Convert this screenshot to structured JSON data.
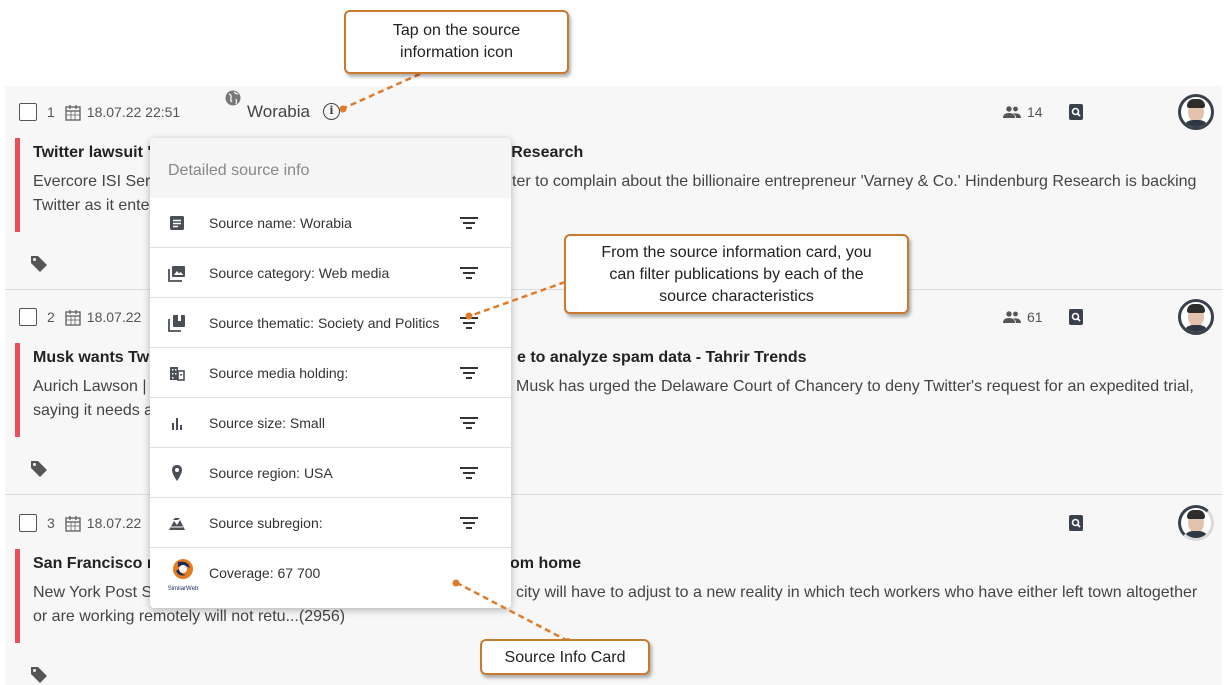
{
  "feed": {
    "items": [
      {
        "index": "1",
        "date": "18.07.22 22:51",
        "source": "Worabia",
        "title": "Twitter lawsuit '",
        "title_tail": "g Research",
        "snippet_line1_left": "Evercore ISI Ser",
        "snippet_line1_right": "ter to complain about the billionaire entrepreneur 'Varney & Co.' Hindenburg Research is backing",
        "snippet_line2_left": "Twitter as it ente",
        "audience": "14"
      },
      {
        "index": "2",
        "date": "18.07.22",
        "title": "Musk wants Twi",
        "title_tail": "e to analyze spam data - Tahrir Trends",
        "snippet_line1_left": "Aurich Lawson |",
        "snippet_line1_right": "Musk has urged the Delaware Court of Chancery to deny Twitter's request for an expedited trial,",
        "snippet_line2_left": "saying it needs a",
        "audience": "61"
      },
      {
        "index": "3",
        "date": "18.07.22",
        "title": "San Francisco m",
        "title_tail": "om home",
        "snippet_line1_left": "New York Post S",
        "snippet_line1_right": "city will have to adjust to a new reality in which tech workers who have either left town altogether",
        "snippet_line2_left": "or are working remotely will not retu...(2956)"
      }
    ]
  },
  "source_card": {
    "title": "Detailed source info",
    "rows": [
      {
        "label": "Source name: Worabia",
        "icon": "article-icon"
      },
      {
        "label": "Source category: Web media",
        "icon": "image-icon"
      },
      {
        "label": "Source thematic: Society and Politics",
        "icon": "library-icon"
      },
      {
        "label": "Source media holding:",
        "icon": "building-icon"
      },
      {
        "label": "Source size: Small",
        "icon": "bar-chart-icon"
      },
      {
        "label": "Source region: USA",
        "icon": "location-pin-icon"
      },
      {
        "label": "Source subregion:",
        "icon": "terrain-icon"
      },
      {
        "label": "Coverage: 67 700",
        "icon": "similarweb-logo"
      }
    ],
    "similarweb_text": "SimilarWeb"
  },
  "callouts": {
    "tap_info": "Tap on the source information icon",
    "tap_info_line1": "Tap on the source",
    "tap_info_line2": "information icon",
    "filter_line1": "From the source information card, you",
    "filter_line2": "can filter publications by each of the",
    "filter_line3": "source characteristics",
    "card_label": "Source Info Card"
  },
  "colors": {
    "accent_bar": "#e8505b",
    "callout_border": "#c87a33",
    "icon": "#4a4f57"
  }
}
